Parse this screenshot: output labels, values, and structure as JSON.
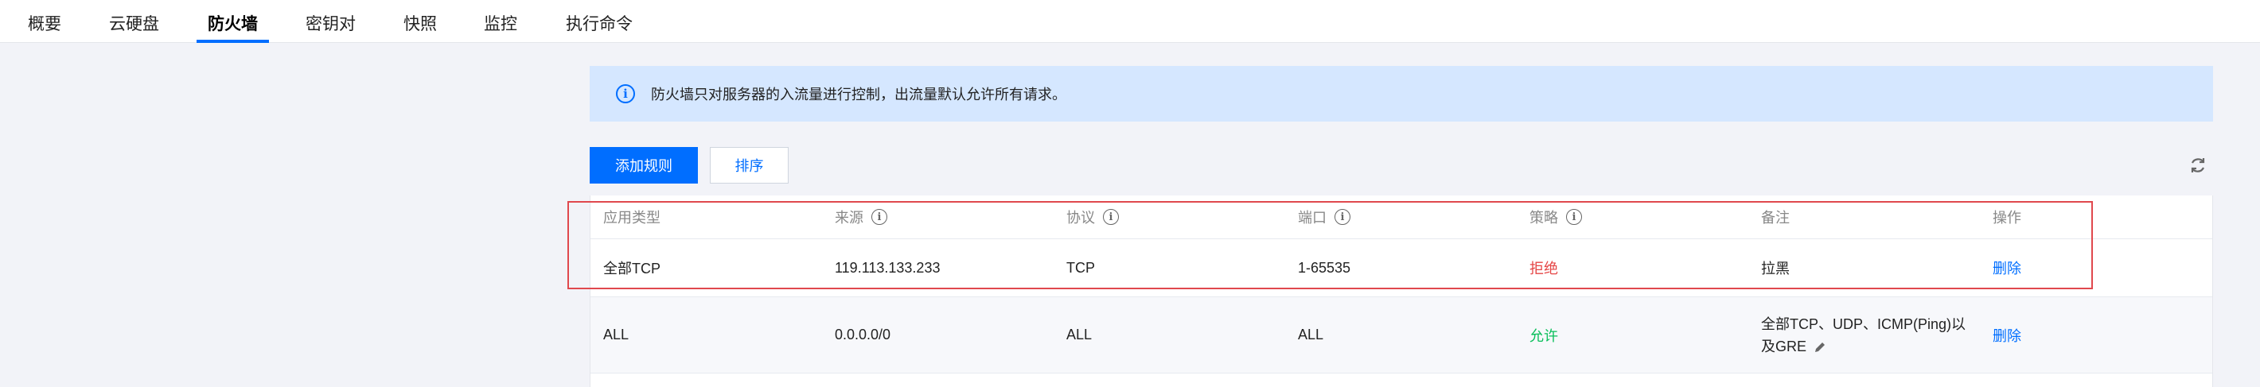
{
  "tabs": [
    {
      "label": "概要",
      "active": false
    },
    {
      "label": "云硬盘",
      "active": false
    },
    {
      "label": "防火墙",
      "active": true
    },
    {
      "label": "密钥对",
      "active": false
    },
    {
      "label": "快照",
      "active": false
    },
    {
      "label": "监控",
      "active": false
    },
    {
      "label": "执行命令",
      "active": false
    }
  ],
  "banner": {
    "icon": "info-icon",
    "text": "防火墙只对服务器的入流量进行控制，出流量默认允许所有请求。"
  },
  "toolbar": {
    "add_rule_label": "添加规则",
    "sort_label": "排序",
    "refresh_icon": "refresh-icon"
  },
  "table": {
    "columns": [
      "应用类型",
      "来源",
      "协议",
      "端口",
      "策略",
      "备注",
      "操作"
    ],
    "rows": [
      {
        "app_type": "全部TCP",
        "source": "119.113.133.233",
        "protocol": "TCP",
        "port": "1-65535",
        "policy": "拒绝",
        "note": "拉黑",
        "action": "删除"
      },
      {
        "app_type": "ALL",
        "source": "0.0.0.0/0",
        "protocol": "ALL",
        "port": "ALL",
        "policy": "允许",
        "note_line1": "全部TCP、UDP、ICMP(Ping)以",
        "note_line2": "及GRE",
        "action": "删除"
      }
    ]
  },
  "colors": {
    "accent": "#006eff",
    "deny": "#e54545",
    "allow": "#0abf5b",
    "banner_bg": "#d5e7ff",
    "highlight": "#e0484d"
  }
}
